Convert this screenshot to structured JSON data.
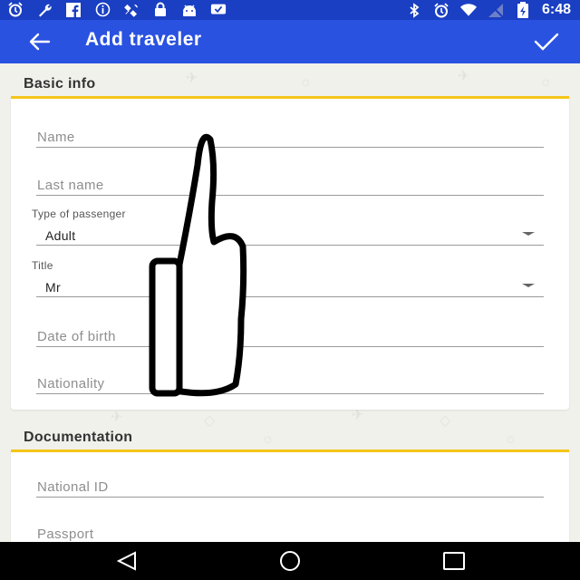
{
  "status_bar": {
    "time": "6:48",
    "left_icons": [
      "alarm-icon",
      "wrench-icon",
      "facebook-icon",
      "info-icon",
      "satellite-icon",
      "lock-icon",
      "android-icon",
      "chat-check-icon"
    ],
    "right_icons": [
      "bluetooth-icon",
      "alarm-icon",
      "wifi-icon",
      "signal-icon",
      "battery-charging-icon"
    ]
  },
  "appbar": {
    "title": "Add traveler",
    "back_icon": "arrow-left-icon",
    "confirm_icon": "check-icon",
    "color": "#2a52e0"
  },
  "basic_info": {
    "title": "Basic info",
    "name_placeholder": "Name",
    "last_name_placeholder": "Last name",
    "passenger_type_label": "Type of passenger",
    "passenger_type_value": "Adult",
    "title_label": "Title",
    "title_value": "Mr",
    "dob_placeholder": "Date of birth",
    "nationality_placeholder": "Nationality"
  },
  "documentation": {
    "title": "Documentation",
    "national_id_placeholder": "National ID",
    "passport_placeholder": "Passport"
  },
  "accent_color": "#f5c518",
  "nav_bar": [
    "back-triangle-icon",
    "home-circle-icon",
    "recents-square-icon"
  ]
}
